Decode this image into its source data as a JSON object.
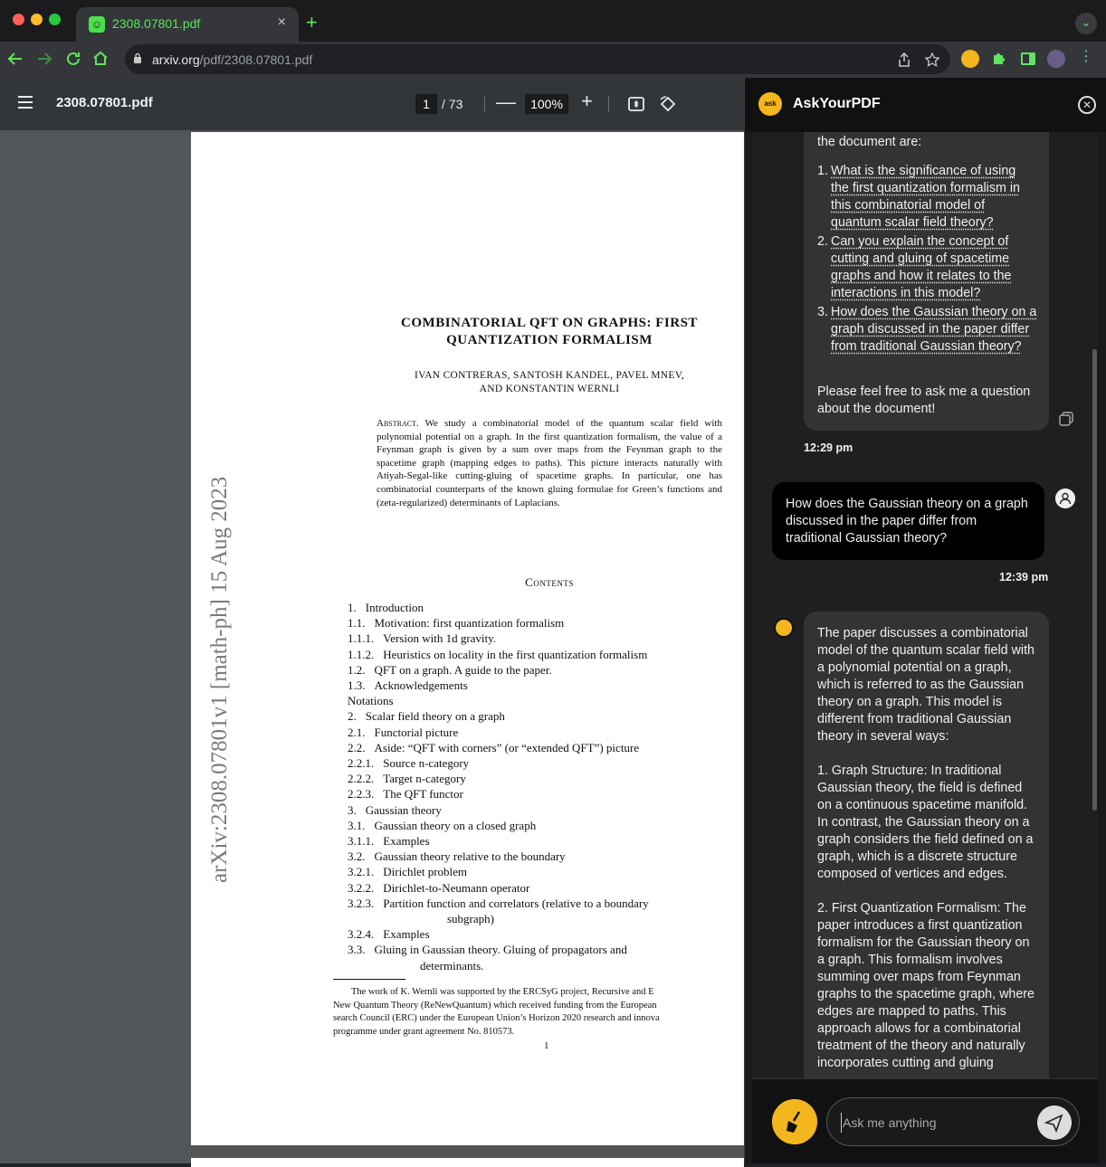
{
  "browser": {
    "tab_title": "2308.07801.pdf",
    "tab_close": "×",
    "new_tab": "+",
    "url_host": "arxiv.org",
    "url_path": "/pdf/2308.07801.pdf"
  },
  "pdf_toolbar": {
    "file_name": "2308.07801.pdf",
    "current_page": "1",
    "page_count": "/ 73",
    "zoom_minus": "—",
    "zoom": "100%",
    "zoom_plus": "+"
  },
  "paper": {
    "arxiv_stamp": "arXiv:2308.07801v1  [math-ph]  15 Aug 2023",
    "title_line1": "COMBINATORIAL QFT ON GRAPHS: FIRST",
    "title_line2": "QUANTIZATION FORMALISM",
    "authors_line1": "IVAN CONTRERAS, SANTOSH KANDEL, PAVEL MNEV,",
    "authors_line2": "AND KONSTANTIN WERNLI",
    "abstract_label": "Abstract.",
    "abstract_text": "We study a combinatorial model of the quantum scalar field with polynomial potential on a graph. In the first quantization formalism, the value of a Feynman graph is given by a sum over maps from the Feynman graph to the spacetime graph (mapping edges to paths). This picture interacts naturally with Atiyah-Segal-like cutting-gluing of spacetime graphs. In particular, one has combinatorial counterparts of the known gluing formulae for Green’s functions and (zeta-regularized) determinants of Laplacians.",
    "contents_heading": "Contents",
    "toc": [
      {
        "num": "1.",
        "text": "Introduction",
        "indent": 0
      },
      {
        "num": "1.1.",
        "text": "Motivation: first quantization formalism",
        "indent": 0
      },
      {
        "num": "1.1.1.",
        "text": "Version with 1d gravity.",
        "indent": 0
      },
      {
        "num": "1.1.2.",
        "text": "Heuristics on locality in the first quantization formalism",
        "indent": 0
      },
      {
        "num": "1.2.",
        "text": "QFT on a graph.  A guide to the paper.",
        "indent": 0
      },
      {
        "num": "1.3.",
        "text": "Acknowledgements",
        "indent": 0
      },
      {
        "num": "",
        "text": "Notations",
        "indent": 0
      },
      {
        "num": "2.",
        "text": "Scalar field theory on a graph",
        "indent": 0
      },
      {
        "num": "2.1.",
        "text": "Functorial picture",
        "indent": 0
      },
      {
        "num": "2.2.",
        "text": "Aside: “QFT with corners” (or “extended QFT”) picture",
        "indent": 0
      },
      {
        "num": "2.2.1.",
        "text": "Source n-category",
        "indent": 0
      },
      {
        "num": "2.2.2.",
        "text": "Target n-category",
        "indent": 0
      },
      {
        "num": "2.2.3.",
        "text": "The QFT functor",
        "indent": 0
      },
      {
        "num": "3.",
        "text": "Gaussian theory",
        "indent": 0
      },
      {
        "num": "3.1.",
        "text": "Gaussian theory on a closed graph",
        "indent": 0
      },
      {
        "num": "3.1.1.",
        "text": "Examples",
        "indent": 0
      },
      {
        "num": "3.2.",
        "text": "Gaussian theory relative to the boundary",
        "indent": 0
      },
      {
        "num": "3.2.1.",
        "text": "Dirichlet problem",
        "indent": 0
      },
      {
        "num": "3.2.2.",
        "text": "Dirichlet-to-Neumann operator",
        "indent": 0
      },
      {
        "num": "3.2.3.",
        "text": "Partition function and correlators (relative to a boundary",
        "indent": 0
      },
      {
        "num": "",
        "text": "subgraph)",
        "indent": 1
      },
      {
        "num": "3.2.4.",
        "text": "Examples",
        "indent": 0
      },
      {
        "num": "3.3.",
        "text": "Gluing  in  Gaussian  theory.   Gluing  of  propagators  and",
        "indent": 0
      },
      {
        "num": "",
        "text": "determinants.",
        "indent": 2
      }
    ],
    "footnote_line1": "The work of K. Wernli was supported by the ERCSyG project, Recursive and E",
    "footnote_line2": "New Quantum Theory (ReNewQuantum) which received funding from the European",
    "footnote_line3": "search Council (ERC) under the European Union’s Horizon 2020 research and innova",
    "footnote_line4": "programme under grant agreement No.  810573.",
    "page_number": "1"
  },
  "panel": {
    "app_name": "AskYourPDF",
    "logo_text": "ask",
    "bot1_intro": "the document are:",
    "bot1_questions": [
      {
        "n": "1.",
        "q": "What is the significance of using the first quantization formalism in this combinatorial model of quantum scalar field theory?"
      },
      {
        "n": "2.",
        "q": "Can you explain the concept of cutting and gluing of spacetime graphs and how it relates to the interactions in this model?"
      },
      {
        "n": "3.",
        "q": "How does the Gaussian theory on a graph discussed in the paper differ from traditional Gaussian theory?"
      }
    ],
    "bot1_outro": "Please feel free to ask me a question about the document!",
    "bot1_time": "12:29 pm",
    "user1_text": "How does the Gaussian theory on a graph discussed in the paper differ from traditional Gaussian theory?",
    "user1_time": "12:39 pm",
    "bot2_paragraphs": [
      "The paper discusses a combinatorial model of the quantum scalar field with a polynomial potential on a graph, which is referred to as the Gaussian theory on a graph. This model is different from traditional Gaussian theory in several ways:",
      "1. Graph Structure: In traditional Gaussian theory, the field is defined on a continuous spacetime manifold. In contrast, the Gaussian theory on a graph considers the field defined on a graph, which is a discrete structure composed of vertices and edges.",
      "2. First Quantization Formalism: The paper introduces a first quantization formalism for the Gaussian theory on a graph. This formalism involves summing over maps from Feynman graphs to the spacetime graph, where edges are mapped to paths. This approach allows for a combinatorial treatment of the theory and naturally incorporates cutting and gluing"
    ],
    "input_placeholder": "Ask me anything"
  },
  "colors": {
    "accent_green": "#5ce65c",
    "brand_yellow": "#f3b61f"
  }
}
